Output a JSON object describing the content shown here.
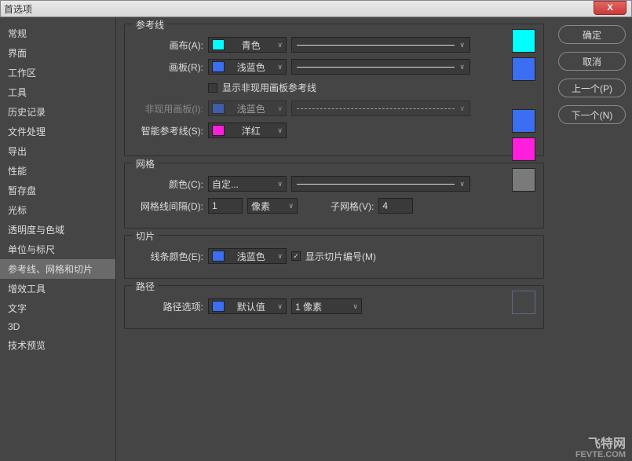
{
  "title": "首选项",
  "close_x": "X",
  "sidebar": [
    "常规",
    "界面",
    "工作区",
    "工具",
    "历史记录",
    "文件处理",
    "导出",
    "性能",
    "暂存盘",
    "光标",
    "透明度与色域",
    "单位与标尺",
    "参考线、网格和切片",
    "增效工具",
    "文字",
    "3D",
    "技术预览"
  ],
  "selected_index": 12,
  "guides": {
    "title": "参考线",
    "canvas_label": "画布(A):",
    "canvas_color_name": "青色",
    "canvas_swatch": "#00ffff",
    "artboard_label": "画板(R):",
    "artboard_color_name": "浅蓝色",
    "artboard_swatch": "#3b6ef0",
    "show_inactive_label": "显示非现用画板参考线",
    "inactive_label": "非现用画板(I):",
    "inactive_color_name": "浅蓝色",
    "inactive_swatch": "#3b6ef0",
    "smart_label": "智能参考线(S):",
    "smart_color_name": "洋红",
    "smart_swatch": "#ff1edc"
  },
  "grid": {
    "title": "网格",
    "color_label": "颜色(C):",
    "color_name": "自定...",
    "swatch": "#7a7a7a",
    "spacing_label": "网格线间隔(D):",
    "spacing_value": "1",
    "spacing_unit": "像素",
    "subdiv_label": "子网格(V):",
    "subdiv_value": "4"
  },
  "slices": {
    "title": "切片",
    "color_label": "线条颜色(E):",
    "color_name": "浅蓝色",
    "color_swatch": "#3b6ef0",
    "show_numbers_label": "显示切片编号(M)"
  },
  "path": {
    "title": "路径",
    "options_label": "路径选项:",
    "options_value": "默认值",
    "options_swatch": "#3b6ef0",
    "width_value": "1 像素"
  },
  "buttons": {
    "ok": "确定",
    "cancel": "取消",
    "prev": "上一个(P)",
    "next": "下一个(N)"
  },
  "watermark": {
    "line1": "飞特网",
    "line2": "FEVTE.COM"
  }
}
